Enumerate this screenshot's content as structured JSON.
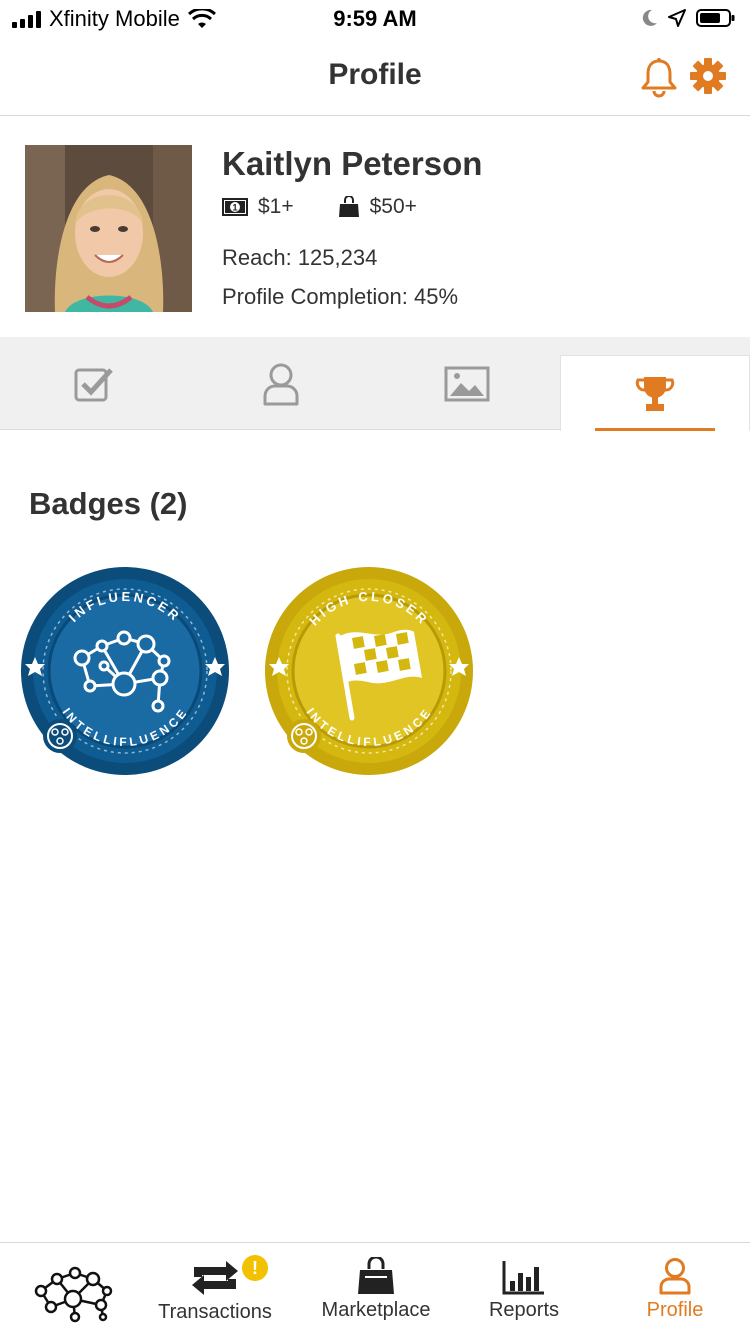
{
  "status_bar": {
    "carrier": "Xfinity Mobile",
    "time": "9:59 AM"
  },
  "nav": {
    "title": "Profile",
    "icons": [
      "bell-icon",
      "gear-icon"
    ]
  },
  "profile": {
    "name": "Kaitlyn Peterson",
    "price_cash": "$1+",
    "price_product": "$50+",
    "reach": "Reach: 125,234",
    "completion": "Profile Completion: 45%"
  },
  "tabs": [
    {
      "icon": "checkbox-icon",
      "active": false
    },
    {
      "icon": "person-icon",
      "active": false
    },
    {
      "icon": "image-icon",
      "active": false
    },
    {
      "icon": "trophy-icon",
      "active": true
    }
  ],
  "badges": {
    "title": "Badges (2)",
    "items": [
      {
        "top_text": "INFLUENCER",
        "bottom_text": "INTELLIFLUENCE",
        "color": "#0f5c92"
      },
      {
        "top_text": "HIGH CLOSER",
        "bottom_text": "INTELLIFLUENCE",
        "color": "#d4b70f"
      }
    ]
  },
  "bottom_tabs": [
    {
      "label": "",
      "icon": "network-logo-icon"
    },
    {
      "label": "Transactions",
      "icon": "transactions-icon",
      "alert": "!"
    },
    {
      "label": "Marketplace",
      "icon": "shopping-bag-icon"
    },
    {
      "label": "Reports",
      "icon": "bar-chart-icon"
    },
    {
      "label": "Profile",
      "icon": "person-icon",
      "active": true
    }
  ],
  "colors": {
    "accent": "#e07b22",
    "influencer_blue": "#0f5c92",
    "closer_yellow": "#d4b70f",
    "alert_yellow": "#f2c200"
  }
}
